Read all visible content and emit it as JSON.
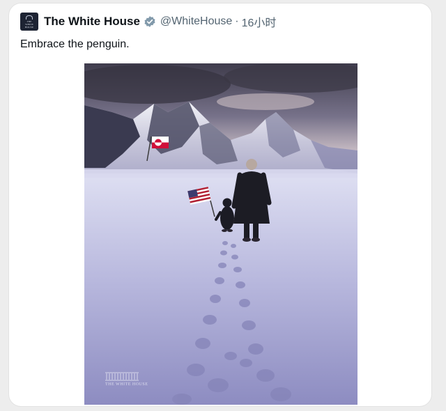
{
  "tweet": {
    "author_name": "The White House",
    "handle": "@WhiteHouse",
    "separator": "·",
    "time": "16小时",
    "text": "Embrace the penguin.",
    "avatar_text": [
      "THE",
      "WHITE",
      "HOUSE"
    ],
    "avatar_bg": "#1d2333",
    "verified_color": "#829aab",
    "verified_icon": "verified-badge-icon"
  },
  "media": {
    "watermark": "THE WHITE HOUSE",
    "scene": {
      "sky_colors": [
        "#3f3c4c",
        "#77728a",
        "#c9bdc5"
      ],
      "snow_colors": [
        "#dedff2",
        "#a9a9d4",
        "#8d8cc1"
      ],
      "flags": [
        "usa-flag",
        "greenland-flag"
      ]
    }
  }
}
